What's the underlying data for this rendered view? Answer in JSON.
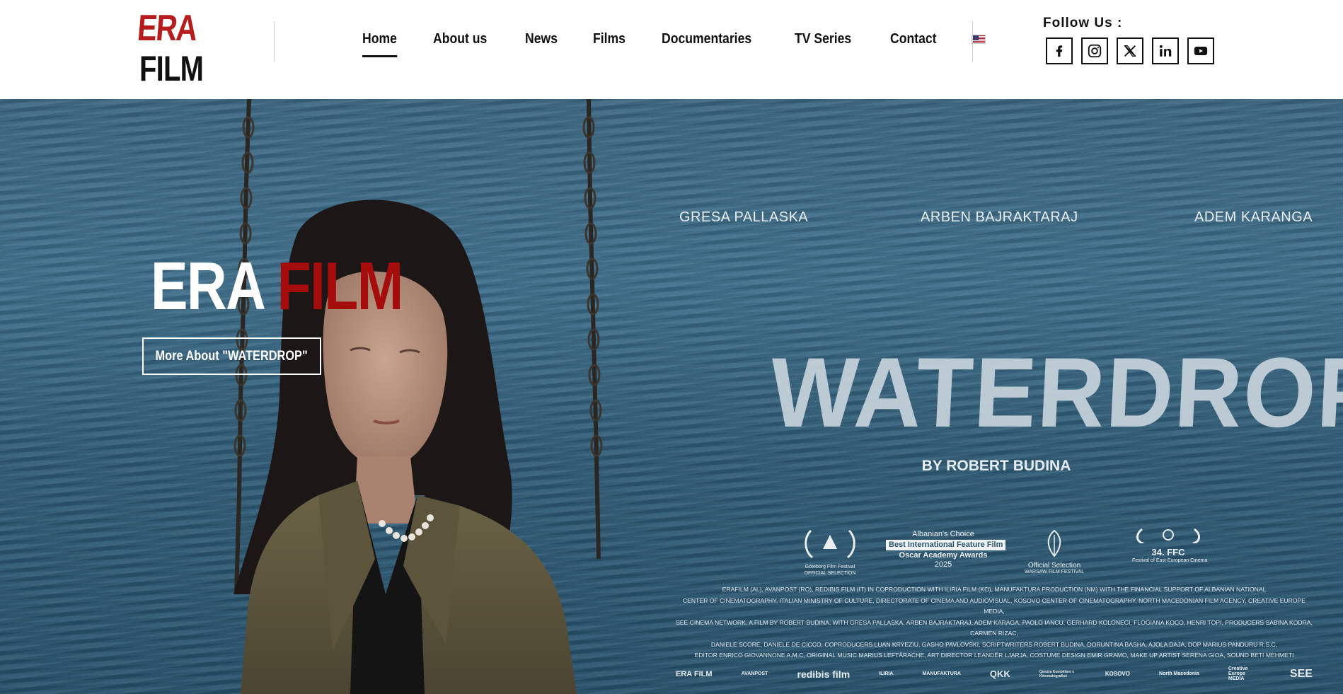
{
  "header": {
    "logo": {
      "top": "ERA",
      "bottom": "FILM"
    },
    "nav": [
      {
        "label": "Home",
        "active": true
      },
      {
        "label": "About us"
      },
      {
        "label": "News"
      },
      {
        "label": "Films"
      },
      {
        "label": "Documentaries"
      },
      {
        "label": "TV Series"
      },
      {
        "label": "Contact"
      }
    ],
    "language_flag": "us-flag-icon",
    "follow_label": "Follow Us :",
    "socials": [
      "facebook-icon",
      "instagram-icon",
      "x-icon",
      "linkedin-icon",
      "youtube-icon"
    ]
  },
  "hero": {
    "title_white": "ERA",
    "title_red": "FILM",
    "button_label": "More About \"WATERDROP\"",
    "poster": {
      "cast": [
        "GRESA PALLASKA",
        "ARBEN BAJRAKTARAJ",
        "ADEM KARANGA"
      ],
      "movie_title": "WATERDROP",
      "director": "BY ROBERT BUDINA",
      "awards": [
        {
          "name": "Göteborg Film Festival",
          "sub": "OFFICIAL SELECTION"
        },
        {
          "lines": [
            "Albanian's Choice",
            "Best International Feature Film",
            "Oscar Academy Awards",
            "2025"
          ]
        },
        {
          "name": "Official Selection",
          "sub": "WARSAW FILM FESTIVAL"
        },
        {
          "name": "34. FFC",
          "sub": "Festival of East European Cinema"
        }
      ],
      "credits": [
        "ERAFILM (AL), AVANPOST (RO), REDIBIS FILM (IT) IN COPRODUCTION WITH ILIRIA FILM (KO), MANUFAKTURA PRODUCTION (NM) WITH THE FINANCIAL SUPPORT OF ALBANIAN NATIONAL",
        "CENTER OF CINEMATOGRAPHY, ITALIAN MINISTRY OF CULTURE, DIRECTORATE OF CINEMA AND AUDIOVISUAL, KOSOVO CENTER OF CINEMATOGRAPHY, NORTH MACEDONIAN FILM AGENCY, CREATIVE EUROPE MEDIA,",
        "SEE CINEMA NETWORK. A FILM BY ROBERT BUDINA, WITH GRESA PALLASKA, ARBEN BAJRAKTARAJ, ADEM KARAGA, PAOLO IANCU, GERHARD KOLONECI, FLOGIANA KOCO, HENRI TOPI, PRODUCERS SABINA KODRA, CARMEN RIZAC,",
        "DANIELE SCORE, DANIELE DE CICCO, COPRODUCERS LUAN KRYEZIU, GASHO PAVLOVSKI, SCRIPTWRITERS ROBERT BUDINA, DORUNTINA BASHA, AJOLA DAJA, DOP MARIUS PANDURU R.S.C,",
        "EDITOR ENRICO GIOVANNONE A.M.C, ORIGINAL MUSIC MARIUS LEFTĂRACHE, ART DIRECTOR LEANDËR LJARJA, COSTUME DESIGN EMIR GRAMO, MAKE UP ARTIST SERENA GIOA, SOUND BETI MEHMETI"
      ],
      "sponsors": [
        "ERA FILM",
        "AVANPOST",
        "redibis film",
        "ILIRIA",
        "MANUFAKTURA",
        "QKK",
        "Qendra Kombëtare e Kinematografisë",
        "KOSOVO",
        "North Macedonia",
        "Creative Europe MEDIA",
        "SEE"
      ]
    }
  }
}
